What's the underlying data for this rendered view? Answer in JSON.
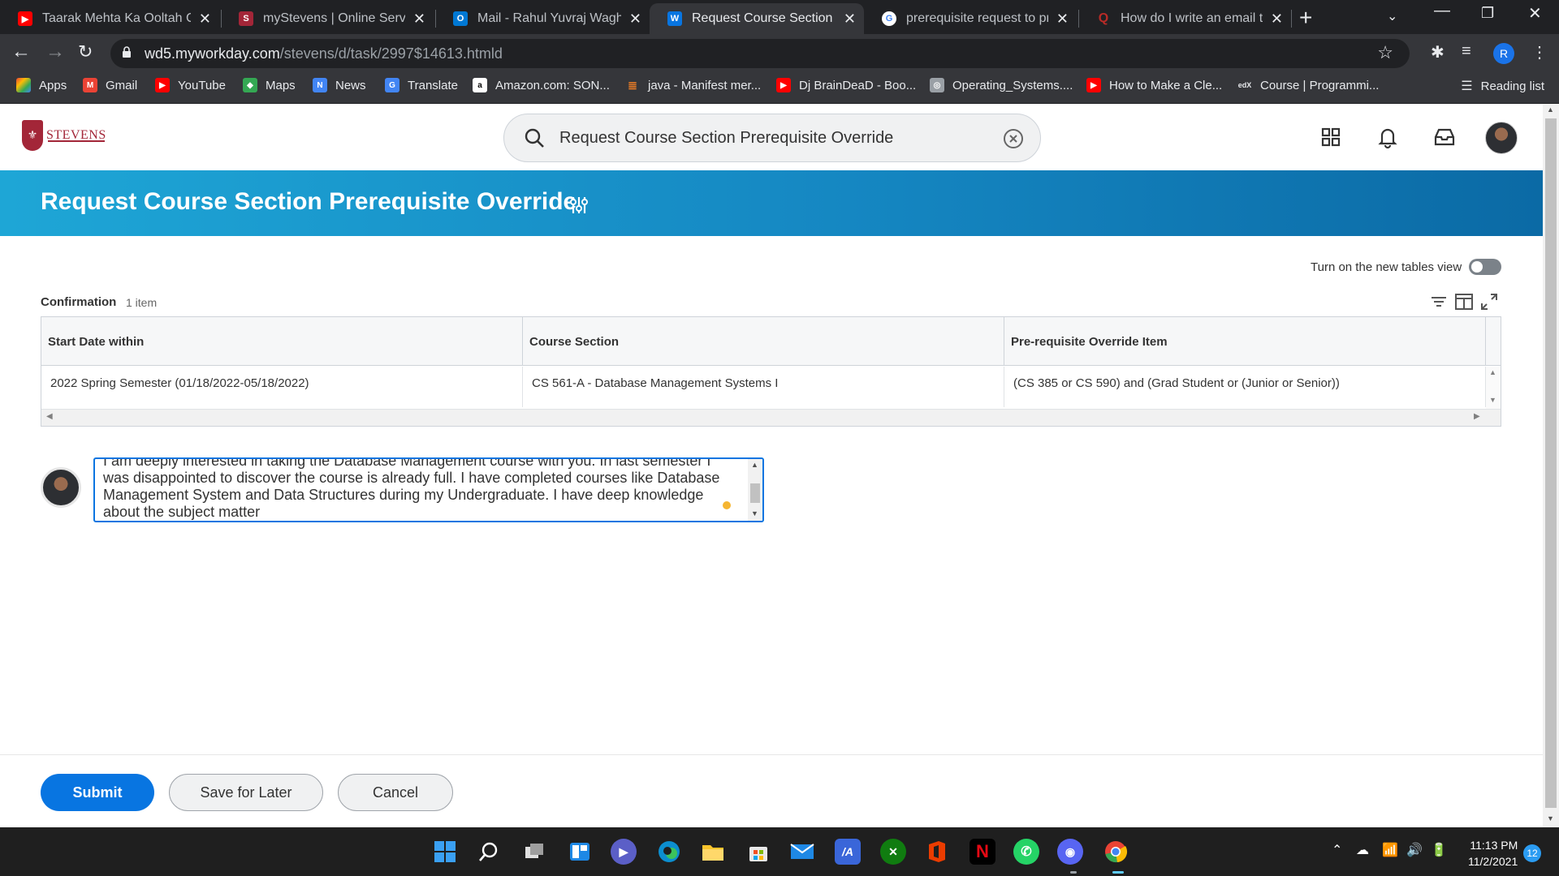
{
  "browser": {
    "tabs": [
      {
        "title": "Taarak Mehta Ka Ooltah Ch",
        "color": "#ff0000"
      },
      {
        "title": "myStevens | Online Services",
        "color": "#a32638"
      },
      {
        "title": "Mail - Rahul Yuvraj Waghul",
        "color": "#0078d4"
      },
      {
        "title": "Request Course Section Pre",
        "color": "#f5b531"
      },
      {
        "title": "prerequisite request to pro",
        "color": "#4285f4"
      },
      {
        "title": "How do I write an email to",
        "color": "#b92b27"
      }
    ],
    "url_host": "wd5.myworkday.com",
    "url_path": "/stevens/d/task/2997$14613.htmld",
    "profile_initial": "R",
    "bookmarks": [
      {
        "label": "Apps",
        "color": "#4285f4"
      },
      {
        "label": "Gmail",
        "color": "#ea4335"
      },
      {
        "label": "YouTube",
        "color": "#ff0000"
      },
      {
        "label": "Maps",
        "color": "#34a853"
      },
      {
        "label": "News",
        "color": "#4285f4"
      },
      {
        "label": "Translate",
        "color": "#4285f4"
      },
      {
        "label": "Amazon.com: SON...",
        "color": "#ffffff"
      },
      {
        "label": "java - Manifest mer...",
        "color": "#f48024"
      },
      {
        "label": "Dj BrainDeaD - Boo...",
        "color": "#ff0000"
      },
      {
        "label": "Operating_Systems....",
        "color": "#9aa0a6"
      },
      {
        "label": "How to Make a Cle...",
        "color": "#ff0000"
      },
      {
        "label": "Course | Programmi...",
        "color": "#35363a"
      }
    ],
    "reading_list": "Reading list"
  },
  "header": {
    "logo_text": "STEVENS",
    "search_value": "Request Course Section Prerequisite Override"
  },
  "banner": {
    "title": "Request Course Section Prerequisite Override"
  },
  "toggle": {
    "label": "Turn on the new tables view"
  },
  "grid": {
    "title": "Confirmation",
    "count": "1 item",
    "columns": [
      "Start Date within",
      "Course Section",
      "Pre-requisite Override Item"
    ],
    "rows": [
      [
        "2022 Spring Semester (01/18/2022-05/18/2022)",
        "CS 561-A - Database Management Systems I",
        "(CS 385 or CS 590) and (Grad Student or (Junior or Senior))"
      ]
    ]
  },
  "comment": {
    "text": "I am deeply interested in taking the Database Management course with you. In last semester I was disappointed to discover the course is already full. I have completed courses like Database Management System and Data Structures during my Undergraduate. I have deep knowledge about the subject matter"
  },
  "actions": {
    "submit": "Submit",
    "save": "Save for Later",
    "cancel": "Cancel"
  },
  "taskbar": {
    "time": "11:13 PM",
    "date": "11/2/2021",
    "notifications": "12"
  },
  "colors": {
    "workday_blue": "#0875e1",
    "banner": "#1587c2",
    "stevens_red": "#a32638"
  }
}
